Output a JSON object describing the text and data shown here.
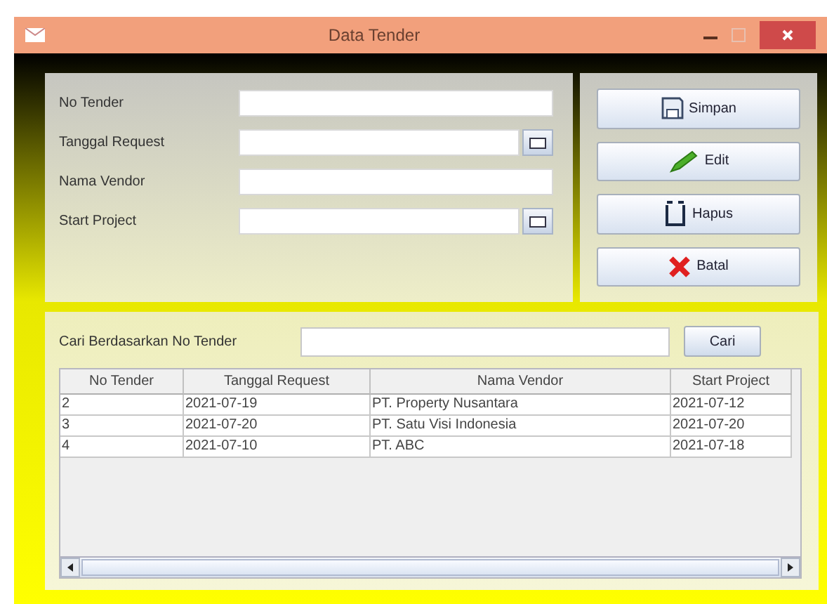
{
  "window": {
    "title": "Data Tender"
  },
  "form": {
    "fields": [
      {
        "label": "No Tender",
        "kind": "text"
      },
      {
        "label": "Tanggal Request",
        "kind": "date"
      },
      {
        "label": "Nama Vendor",
        "kind": "text"
      },
      {
        "label": "Start Project",
        "kind": "date"
      }
    ]
  },
  "buttons": [
    {
      "label": "Simpan",
      "kind": "save"
    },
    {
      "label": "Edit",
      "kind": "edit"
    },
    {
      "label": "Hapus",
      "kind": "delete"
    },
    {
      "label": "Batal",
      "kind": "cancel"
    }
  ],
  "search": {
    "label": "Cari Berdasarkan No Tender",
    "button": "Cari"
  },
  "table": {
    "columns": [
      "No Tender",
      "Tanggal Request",
      "Nama Vendor",
      "Start Project"
    ],
    "rows": [
      [
        "2",
        "2021-07-19",
        "PT. Property Nusantara",
        "2021-07-12"
      ],
      [
        "3",
        "2021-07-20",
        "PT. Satu Visi Indonesia",
        "2021-07-20"
      ],
      [
        "4",
        "2021-07-10",
        "PT. ABC",
        "2021-07-18"
      ]
    ]
  }
}
